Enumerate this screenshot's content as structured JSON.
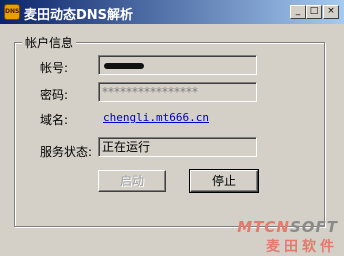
{
  "window": {
    "title": "麦田动态DNS解析",
    "icon": "app-logo-icon",
    "icon_text": "DNS",
    "controls": {
      "minimize": "_",
      "maximize": "□",
      "close": "×"
    }
  },
  "group": {
    "title": "帐户信息",
    "account": {
      "label": "帐号:",
      "value": ""
    },
    "password": {
      "label": "密码:",
      "value": "****************"
    },
    "domain": {
      "label": "域名:",
      "value": "chengli.mt666.cn"
    },
    "service": {
      "label": "服务状态:",
      "value": "正在运行"
    }
  },
  "buttons": {
    "start": "启动",
    "stop": "停止"
  },
  "watermark": {
    "brand_red": "MTCN",
    "brand_gray": "SOFT",
    "subtitle": "麦田软件"
  },
  "colors": {
    "title_bar_start": "#0a246a",
    "title_bar_end": "#a6caf0",
    "link": "#0000cc",
    "watermark": "#e37a6d"
  }
}
